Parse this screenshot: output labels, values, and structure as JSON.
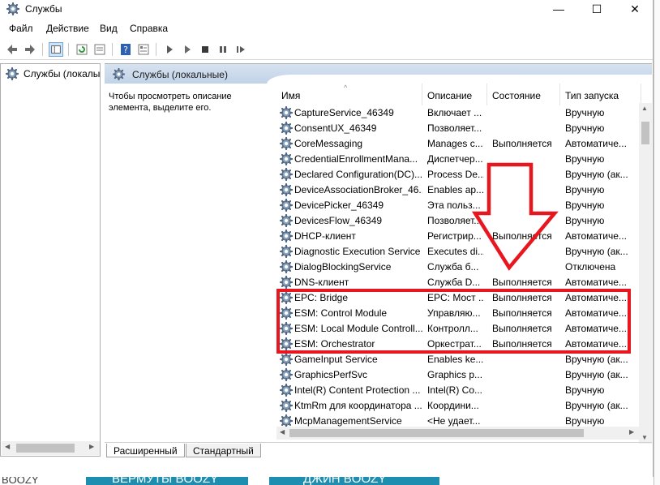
{
  "window": {
    "title": "Службы",
    "min_glyph": "—",
    "max_glyph": "☐",
    "close_glyph": "✕"
  },
  "menu": [
    "Файл",
    "Действие",
    "Вид",
    "Справка"
  ],
  "tree": {
    "item_label": "Службы (локалы"
  },
  "main": {
    "header_title": "Службы (локальные)",
    "description": "Чтобы просмотреть описание элемента, выделите его.",
    "columns": [
      "Имя",
      "Описание",
      "Состояние",
      "Тип запуска"
    ],
    "sort_glyph": "^"
  },
  "services": [
    {
      "name": "CaptureService_46349",
      "desc": "Включает ...",
      "state": "",
      "start": "Вручную"
    },
    {
      "name": "ConsentUX_46349",
      "desc": "Позволяет...",
      "state": "",
      "start": "Вручную"
    },
    {
      "name": "CoreMessaging",
      "desc": "Manages c...",
      "state": "Выполняется",
      "start": "Автоматиче..."
    },
    {
      "name": "CredentialEnrollmentMana...",
      "desc": "Диспетчер...",
      "state": "",
      "start": "Вручную"
    },
    {
      "name": "Declared Configuration(DC)...",
      "desc": "Process De...",
      "state": "",
      "start": "Вручную (ак..."
    },
    {
      "name": "DeviceAssociationBroker_46...",
      "desc": "Enables ap...",
      "state": "",
      "start": "Вручную"
    },
    {
      "name": "DevicePicker_46349",
      "desc": "Эта польз...",
      "state": "",
      "start": "Вручную"
    },
    {
      "name": "DevicesFlow_46349",
      "desc": "Позволяет...",
      "state": "",
      "start": "Вручную"
    },
    {
      "name": "DHCP-клиент",
      "desc": "Регистрир...",
      "state": "Выполняется",
      "start": "Автоматиче..."
    },
    {
      "name": "Diagnostic Execution Service",
      "desc": "Executes di...",
      "state": "",
      "start": "Вручную (ак..."
    },
    {
      "name": "DialogBlockingService",
      "desc": "Служба б...",
      "state": "",
      "start": "Отключена"
    },
    {
      "name": "DNS-клиент",
      "desc": "Служба D...",
      "state": "Выполняется",
      "start": "Автоматиче..."
    },
    {
      "name": "EPC: Bridge",
      "desc": "EPC: Мост ...",
      "state": "Выполняется",
      "start": "Автоматиче..."
    },
    {
      "name": "ESM: Control Module",
      "desc": "Управляю...",
      "state": "Выполняется",
      "start": "Автоматиче..."
    },
    {
      "name": "ESM: Local Module Controll...",
      "desc": "Контролл...",
      "state": "Выполняется",
      "start": "Автоматиче..."
    },
    {
      "name": "ESM: Orchestrator",
      "desc": "Оркестрат...",
      "state": "Выполняется",
      "start": "Автоматиче..."
    },
    {
      "name": "GameInput Service",
      "desc": "Enables ke...",
      "state": "",
      "start": "Вручную (ак..."
    },
    {
      "name": "GraphicsPerfSvc",
      "desc": "Graphics p...",
      "state": "",
      "start": "Вручную (ак..."
    },
    {
      "name": "Intel(R) Content Protection ...",
      "desc": "Intel(R) Co...",
      "state": "",
      "start": "Вручную"
    },
    {
      "name": "KtmRm для координатора ...",
      "desc": "Координи...",
      "state": "",
      "start": "Вручную (ак..."
    },
    {
      "name": "McpManagementService",
      "desc": "<Не удает...",
      "state": "",
      "start": "Вручную"
    }
  ],
  "tabs": [
    "Расширенный",
    "Стандартный"
  ],
  "background_page": {
    "left_text": "BOOZY",
    "banner_1": "ВЕРМУТЫ BOOZY",
    "banner_2": "ДЖИН BOOZY"
  },
  "colors": {
    "highlight": "#e8161f",
    "header_gradient_top": "#d6e2f0",
    "banner": "#1d8db0"
  }
}
